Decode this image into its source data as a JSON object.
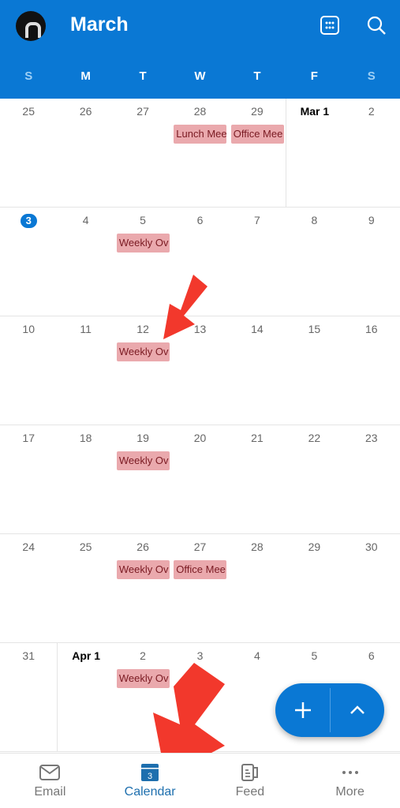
{
  "header": {
    "title": "March",
    "avatar_label": "profile avatar"
  },
  "weekdays": [
    "S",
    "M",
    "T",
    "W",
    "T",
    "F",
    "S"
  ],
  "weeks": [
    {
      "days": [
        {
          "d": "25"
        },
        {
          "d": "26"
        },
        {
          "d": "27"
        },
        {
          "d": "28",
          "event": "Lunch Mee"
        },
        {
          "d": "29",
          "event": "Office Mee"
        },
        {
          "d": "Mar 1",
          "bold": true,
          "sep": true
        },
        {
          "d": "2"
        }
      ]
    },
    {
      "days": [
        {
          "d": "3",
          "today": true
        },
        {
          "d": "4"
        },
        {
          "d": "5",
          "event": "Weekly Ov"
        },
        {
          "d": "6"
        },
        {
          "d": "7"
        },
        {
          "d": "8"
        },
        {
          "d": "9"
        }
      ]
    },
    {
      "days": [
        {
          "d": "10"
        },
        {
          "d": "11"
        },
        {
          "d": "12",
          "event": "Weekly Ov"
        },
        {
          "d": "13"
        },
        {
          "d": "14"
        },
        {
          "d": "15"
        },
        {
          "d": "16"
        }
      ]
    },
    {
      "days": [
        {
          "d": "17"
        },
        {
          "d": "18"
        },
        {
          "d": "19",
          "event": "Weekly Ov"
        },
        {
          "d": "20"
        },
        {
          "d": "21"
        },
        {
          "d": "22"
        },
        {
          "d": "23"
        }
      ]
    },
    {
      "days": [
        {
          "d": "24"
        },
        {
          "d": "25"
        },
        {
          "d": "26",
          "event": "Weekly Ov"
        },
        {
          "d": "27",
          "event": "Office Mee"
        },
        {
          "d": "28"
        },
        {
          "d": "29"
        },
        {
          "d": "30"
        }
      ]
    },
    {
      "days": [
        {
          "d": "31"
        },
        {
          "d": "Apr 1",
          "bold": true,
          "sep": true
        },
        {
          "d": "2",
          "event": "Weekly Ov"
        },
        {
          "d": "3"
        },
        {
          "d": "4"
        },
        {
          "d": "5"
        },
        {
          "d": "6"
        }
      ]
    }
  ],
  "nav": {
    "email": "Email",
    "calendar": "Calendar",
    "calendar_badge": "3",
    "feed": "Feed",
    "more": "More"
  },
  "colors": {
    "brand": "#0a78d4",
    "event": "#eaa9ad",
    "annotation_arrow": "#f2382c"
  }
}
